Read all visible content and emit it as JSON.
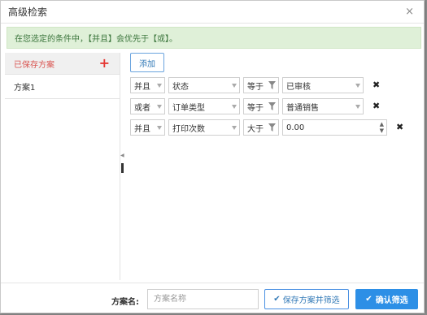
{
  "dialog": {
    "title": "高级检索",
    "close_glyph": "×",
    "notice": "在您选定的条件中，【并且】会优先于【或】。"
  },
  "sidebar": {
    "header": "已保存方案",
    "add_glyph": "+",
    "items": [
      {
        "label": "方案1"
      }
    ]
  },
  "main": {
    "add_label": "添加",
    "conditions": [
      {
        "logic": "并且",
        "field": "状态",
        "operator": "等于",
        "value": "已审核"
      },
      {
        "logic": "或者",
        "field": "订单类型",
        "operator": "等于",
        "value": "普通销售"
      },
      {
        "logic": "并且",
        "field": "打印次数",
        "operator": "大于",
        "value": "0.00"
      }
    ],
    "delete_glyph": "✖"
  },
  "footer": {
    "name_label": "方案名:",
    "name_placeholder": "方案名称",
    "save_label": "保存方案并筛选",
    "confirm_label": "确认筛选",
    "check_glyph": "✔"
  },
  "colors": {
    "accent": "#2d8fe6",
    "alert_bg": "#dff0d8",
    "alert_text": "#3c763d",
    "danger": "#e53935"
  }
}
